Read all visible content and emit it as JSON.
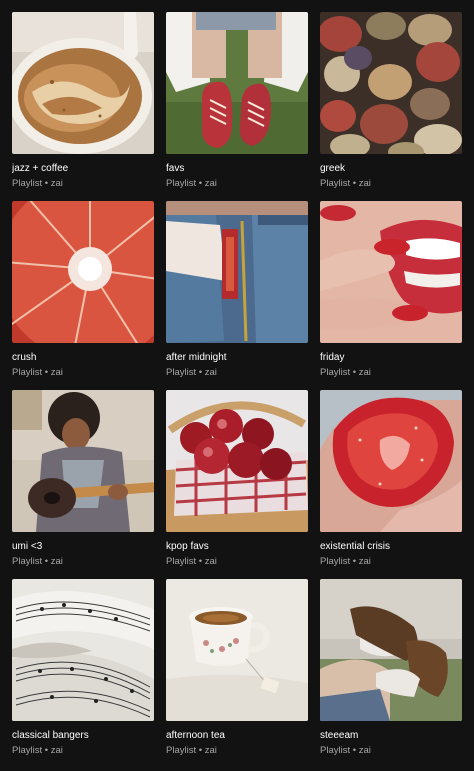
{
  "playlists": [
    {
      "title": "jazz + coffee",
      "subtitle": "Playlist • zai",
      "cover_icon": "coffee-latte-art"
    },
    {
      "title": "favs",
      "subtitle": "Playlist • zai",
      "cover_icon": "red-sneakers-on-grass"
    },
    {
      "title": "greek",
      "subtitle": "Playlist • zai",
      "cover_icon": "polished-stones"
    },
    {
      "title": "crush",
      "subtitle": "Playlist • zai",
      "cover_icon": "grapefruit-slice"
    },
    {
      "title": "after midnight",
      "subtitle": "Playlist • zai",
      "cover_icon": "denim-jeans-zipper"
    },
    {
      "title": "friday",
      "subtitle": "Playlist • zai",
      "cover_icon": "red-nails-lips"
    },
    {
      "title": "umi <3",
      "subtitle": "Playlist • zai",
      "cover_icon": "girl-with-guitar"
    },
    {
      "title": "kpop favs",
      "subtitle": "Playlist • zai",
      "cover_icon": "apple-basket"
    },
    {
      "title": "existential crisis",
      "subtitle": "Playlist • zai",
      "cover_icon": "strawberry-half"
    },
    {
      "title": "classical bangers",
      "subtitle": "Playlist • zai",
      "cover_icon": "sheet-music"
    },
    {
      "title": "afternoon tea",
      "subtitle": "Playlist • zai",
      "cover_icon": "teacup"
    },
    {
      "title": "steeeam",
      "subtitle": "Playlist • zai",
      "cover_icon": "loafers-socks"
    }
  ]
}
